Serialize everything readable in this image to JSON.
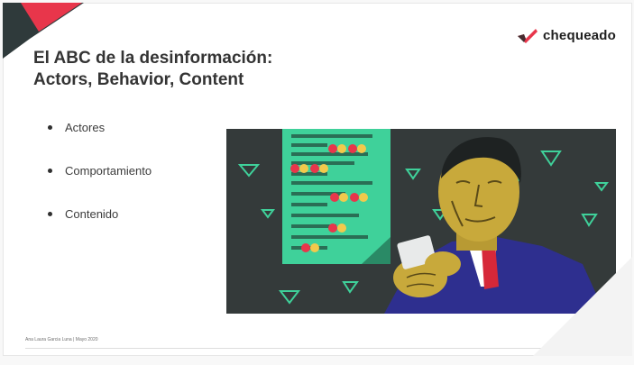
{
  "slide": {
    "title_line1": "El ABC de la desinformación:",
    "title_line2": "Actors, Behavior, Content",
    "bullets": [
      "Actores",
      "Comportamiento",
      "Contenido"
    ],
    "footer": "Ana Laura Garcia Luna | Mayo 2020"
  },
  "brand": {
    "logo_text": "chequeado",
    "accent_color": "#e8364b",
    "dark_color": "#2f3a3b",
    "illustration_bg": "#343a3a",
    "document_green": "#3fd19a",
    "suit_blue": "#2e2f8f",
    "face_yellow": "#c8a93b"
  },
  "icons": {
    "logo_mark": "chequeado-check-icon",
    "bullet": "bullet-dot-icon"
  }
}
